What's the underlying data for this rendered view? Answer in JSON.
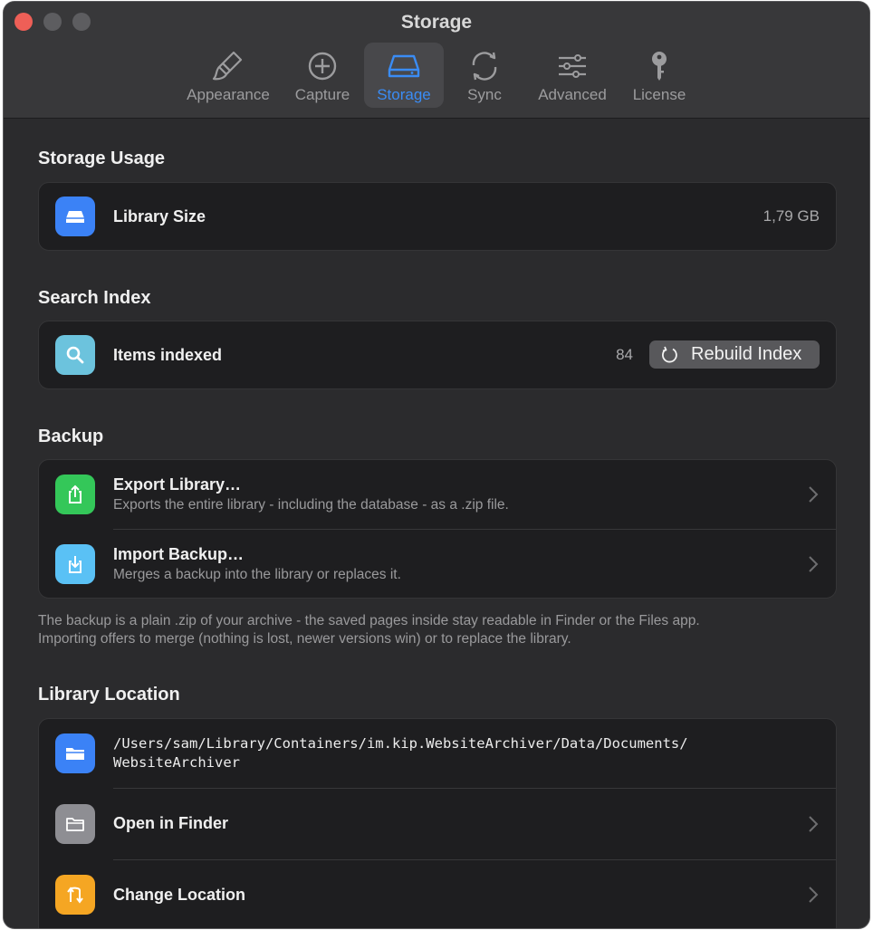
{
  "window": {
    "title": "Storage"
  },
  "tabs": [
    {
      "label": "Appearance",
      "icon": "paintbrush-icon"
    },
    {
      "label": "Capture",
      "icon": "plus-circle-icon"
    },
    {
      "label": "Storage",
      "icon": "drive-icon",
      "active": true
    },
    {
      "label": "Sync",
      "icon": "sync-icon"
    },
    {
      "label": "Advanced",
      "icon": "sliders-icon"
    },
    {
      "label": "License",
      "icon": "key-icon"
    }
  ],
  "storage_usage": {
    "title": "Storage Usage",
    "library_size_label": "Library Size",
    "library_size_value": "1,79 GB"
  },
  "search_index": {
    "title": "Search Index",
    "items_label": "Items indexed",
    "items_value": "84",
    "rebuild_label": "Rebuild Index"
  },
  "backup": {
    "title": "Backup",
    "export_label": "Export Library…",
    "export_sub": "Exports the entire library - including the database - as a .zip file.",
    "import_label": "Import Backup…",
    "import_sub": "Merges a backup into the library or replaces it.",
    "footnote_line1": "The backup is a plain .zip of your archive - the saved pages inside stay readable in Finder or the Files app.",
    "footnote_line2": "Importing offers to merge (nothing is lost, newer versions win) or to replace the library."
  },
  "library_location": {
    "title": "Library Location",
    "path_line1": "/Users/sam/Library/Containers/im.kip.WebsiteArchiver/Data/Documents/",
    "path_line2": "WebsiteArchiver",
    "open_in_finder_label": "Open in Finder",
    "change_location_label": "Change Location"
  },
  "colors": {
    "accent": "#3a8cf5",
    "icon_blue": "#3b82f6",
    "icon_teal": "#6cc3dd",
    "icon_green": "#34c759",
    "icon_lightblue": "#5ac1f5",
    "icon_gray": "#8e8e93",
    "icon_orange": "#f5a623"
  }
}
